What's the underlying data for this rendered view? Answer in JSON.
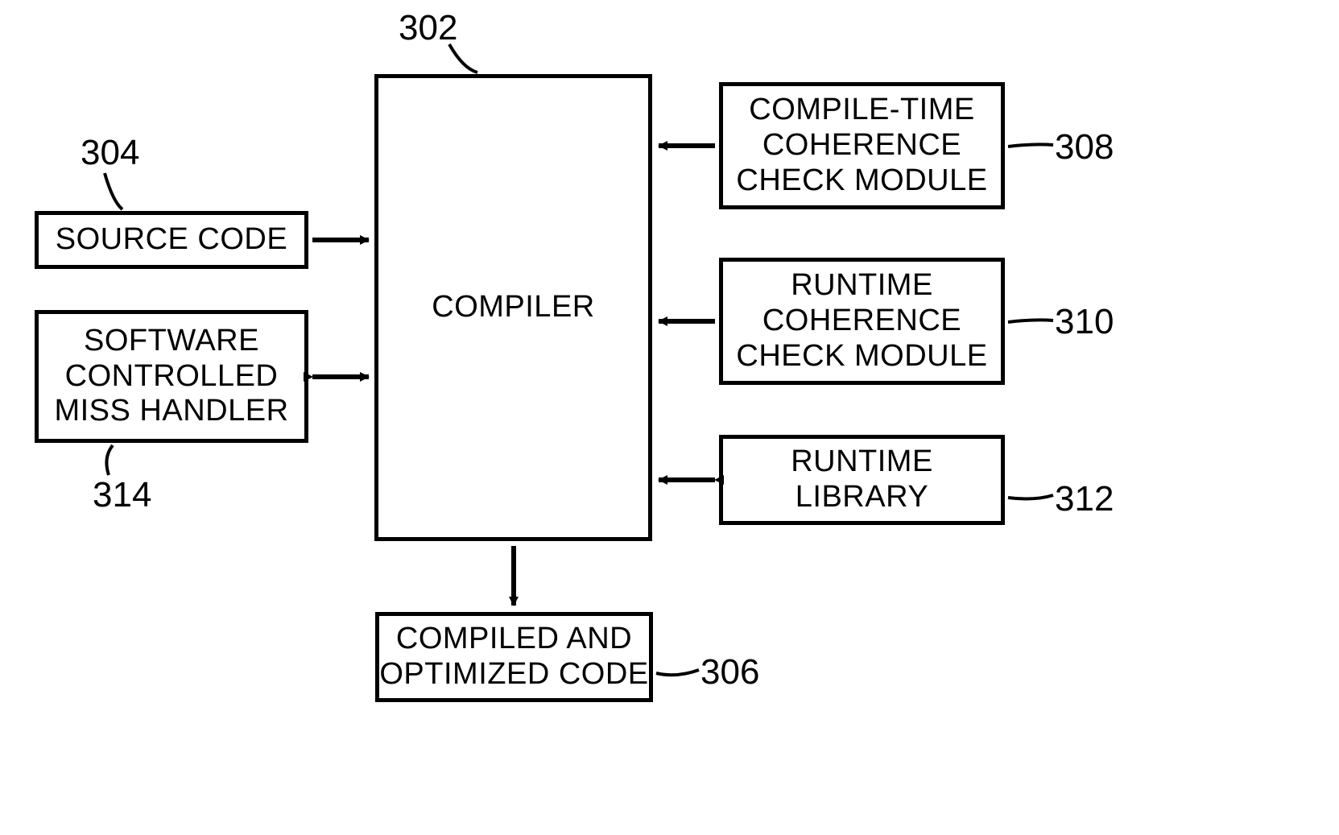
{
  "refs": {
    "compiler": "302",
    "source_code": "304",
    "compiled_optimized": "306",
    "compile_time_module": "308",
    "runtime_module": "310",
    "runtime_library": "312",
    "miss_handler": "314"
  },
  "labels": {
    "compiler": "COMPILER",
    "source_code": "SOURCE CODE",
    "miss_handler": "SOFTWARE\nCONTROLLED\nMISS HANDLER",
    "compile_time_module": "COMPILE-TIME\nCOHERENCE\nCHECK MODULE",
    "runtime_module": "RUNTIME\nCOHERENCE\nCHECK MODULE",
    "runtime_library": "RUNTIME\nLIBRARY",
    "compiled_optimized": "COMPILED AND\nOPTIMIZED CODE"
  }
}
